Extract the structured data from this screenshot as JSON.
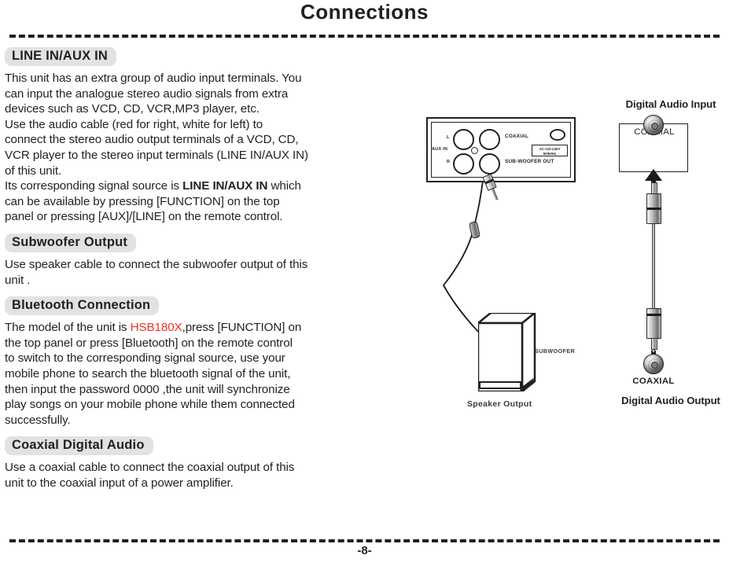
{
  "page": {
    "title": "Connections",
    "page_number": "-8-"
  },
  "sections": [
    {
      "heading": "LINE IN/AUX IN",
      "paragraphs": [
        {
          "runs": [
            {
              "text": "This unit has an extra group of audio input terminals. You\ncan input the analogue stereo audio signals from extra\ndevices such as  VCD, CD, VCR,MP3 player, etc.\nUse the audio cable (red for right, white for left) to\nconnect the stereo audio output terminals of a VCD, CD,\nVCR player to the stereo input terminals (LINE IN/AUX IN)\nof this unit.\nIts corresponding signal source is ",
              "style": "normal"
            },
            {
              "text": "LINE IN/AUX IN",
              "style": "bold"
            },
            {
              "text": " which\ncan be available by pressing [FUNCTION] on the top\npanel or pressing [AUX]/[LINE] on the remote control.",
              "style": "normal"
            }
          ]
        }
      ]
    },
    {
      "heading": "Subwoofer Output",
      "paragraphs": [
        {
          "runs": [
            {
              "text": "Use speaker cable to connect the subwoofer output of this\nunit .",
              "style": "normal"
            }
          ]
        }
      ]
    },
    {
      "heading": "Bluetooth Connection",
      "paragraphs": [
        {
          "runs": [
            {
              "text": "The model of the unit is ",
              "style": "normal"
            },
            {
              "text": "HSB180X",
              "style": "red"
            },
            {
              "text": ",press [FUNCTION] on\nthe top panel or press [Bluetooth] on the remote control\nto switch to the corresponding signal source, use your\nmobile phone to search the bluetooth signal of the unit,\nthen input the password 0000 ,the unit will synchronize\nplay songs on your mobile phone while them connected\nsuccessfully.",
              "style": "normal"
            }
          ]
        }
      ]
    },
    {
      "heading": "Coaxial Digital Audio",
      "paragraphs": [
        {
          "runs": [
            {
              "text": "Use a coaxial cable to connect the coaxial output of this\nunit to the coaxial input of a power amplifier.",
              "style": "normal"
            }
          ]
        }
      ]
    }
  ],
  "diagram": {
    "rear_panel": {
      "label_l": "L",
      "label_r": "R",
      "label_aux_in": "AUX IN",
      "label_coaxial": "COAXIAL",
      "label_subwoofer_out": "SUB-WOOFER OUT",
      "ac_rating": "AC-110-240V\n50/60Hz"
    },
    "subwoofer_label": "SUBWOOFER",
    "speaker_output_label": "Speaker Output",
    "digital_audio_input_label": "Digital  Audio Input",
    "digital_audio_output_label": "Digital  Audio Output",
    "coaxial_input_label": "COAXIAL",
    "coaxial_output_label": "COAXIAL"
  },
  "colors": {
    "badge_bg": "#e2e2e2",
    "ink": "#231f20",
    "model_red": "#ef3124"
  }
}
